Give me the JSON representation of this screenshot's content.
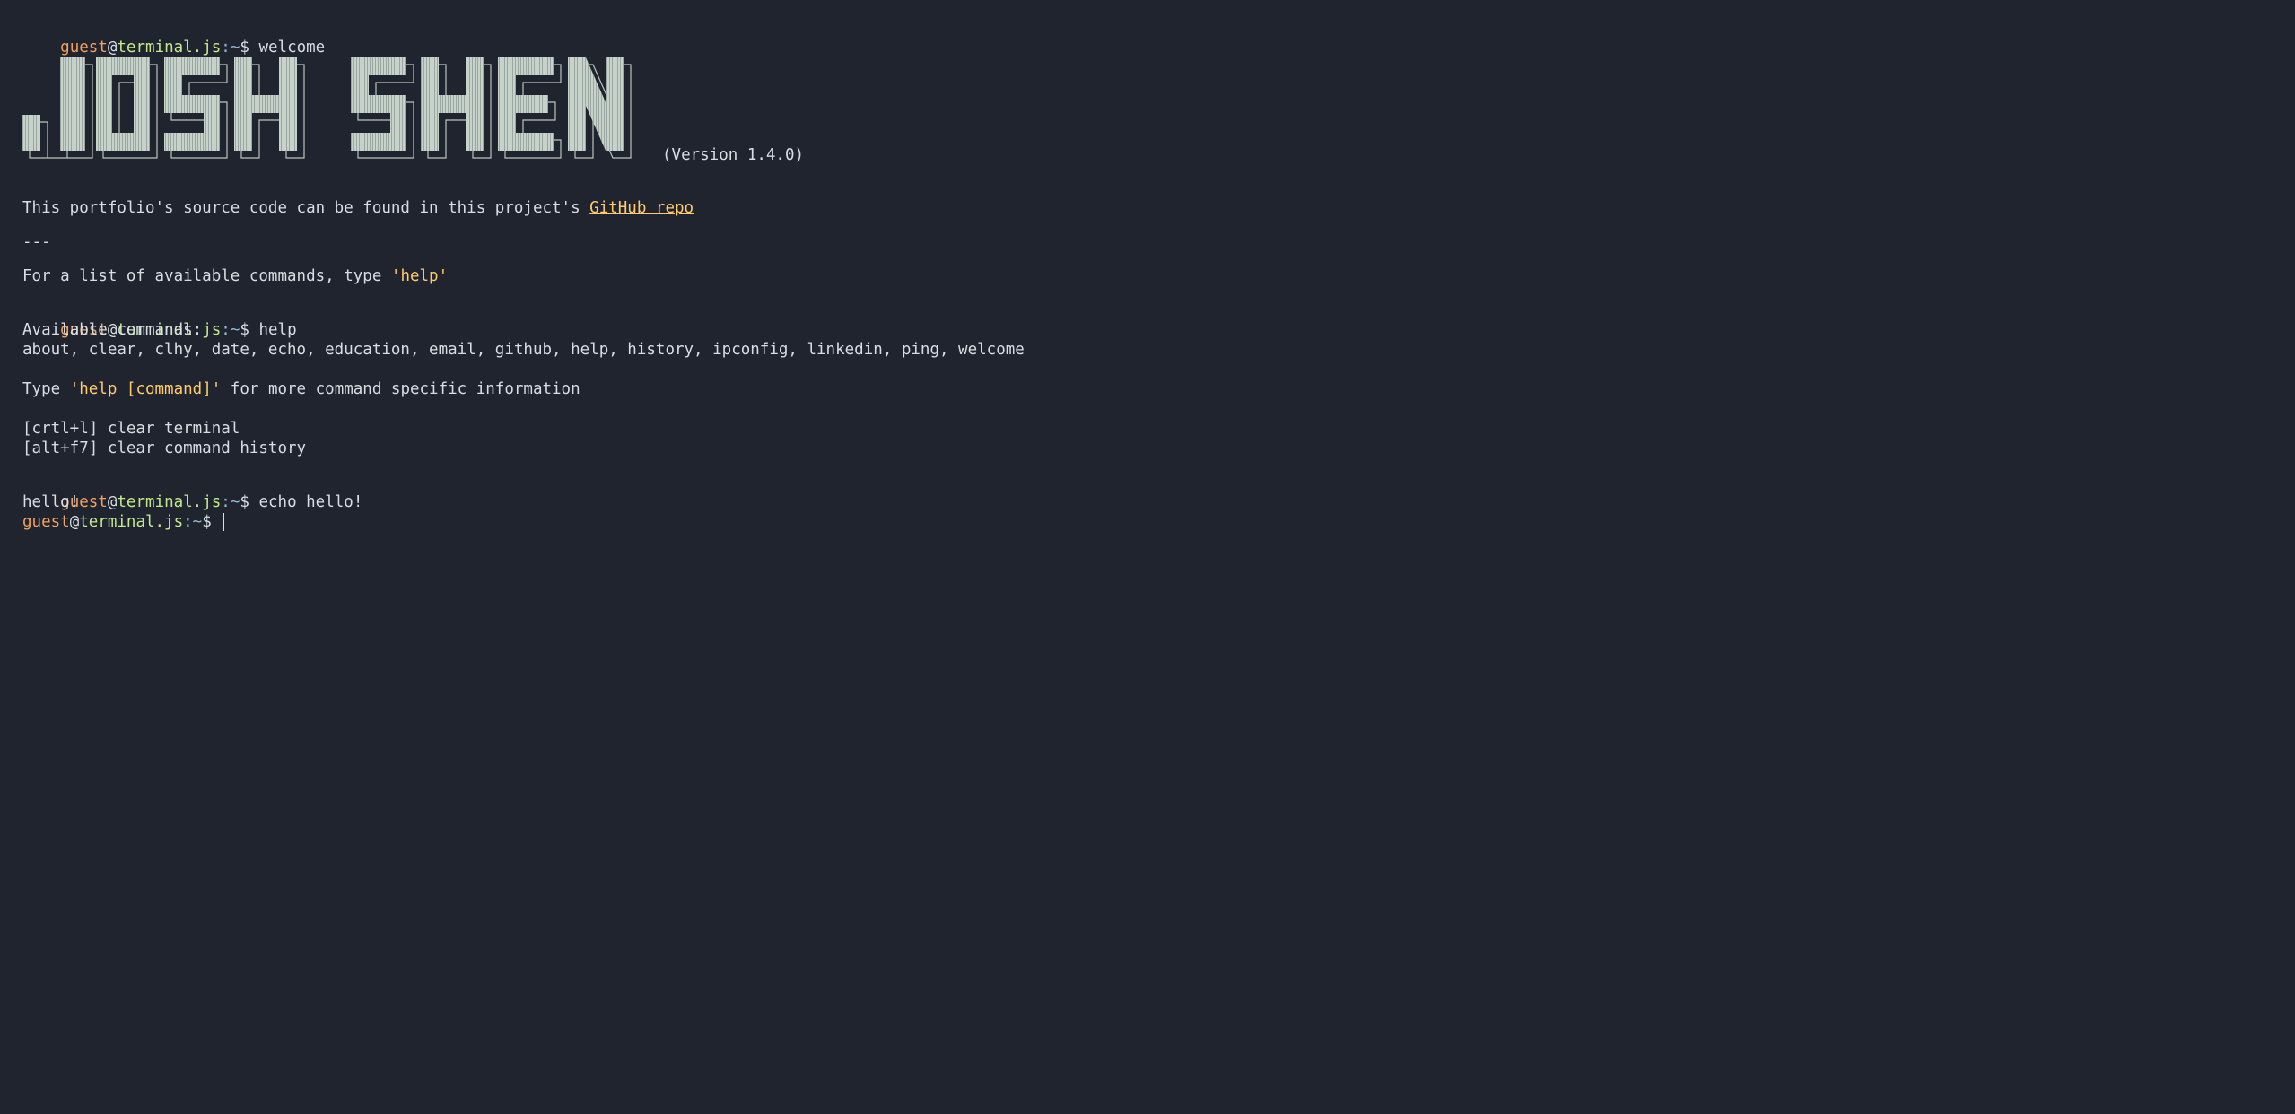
{
  "prompt": {
    "user": "guest",
    "at": "@",
    "host": "terminal.js",
    "path": ":~",
    "symbol": "$"
  },
  "history": [
    {
      "command": "welcome"
    },
    {
      "command": "help"
    },
    {
      "command": "echo hello!"
    }
  ],
  "welcome": {
    "banner_text": "JOSH SHEN",
    "version": "(Version 1.4.0)",
    "source_text": "This portfolio's source code can be found in this project's ",
    "source_link": "GitHub repo",
    "separator": "---",
    "help_hint_prefix": "For a list of available commands, type ",
    "help_hint_command": "'help'"
  },
  "help": {
    "heading": "Available commands:",
    "commands": "about, clear, clhy, date, echo, education, email, github, help, history, ipconfig, linkedin, ping, welcome",
    "type_prefix": "Type ",
    "type_command": "'help [command]'",
    "type_suffix": " for more command specific information",
    "shortcut_1": "[crtl+l] clear terminal",
    "shortcut_2": "[alt+f7] clear command history"
  },
  "echo": {
    "output": "hello!"
  },
  "input": {
    "value": ""
  },
  "colors": {
    "background": "#20242f",
    "text": "#d8dde3",
    "user": "#f0a15f",
    "host": "#c3e88d",
    "path": "#8fbad6",
    "highlight": "#ffcb6b",
    "banner_fill": "#c7d2cb"
  }
}
